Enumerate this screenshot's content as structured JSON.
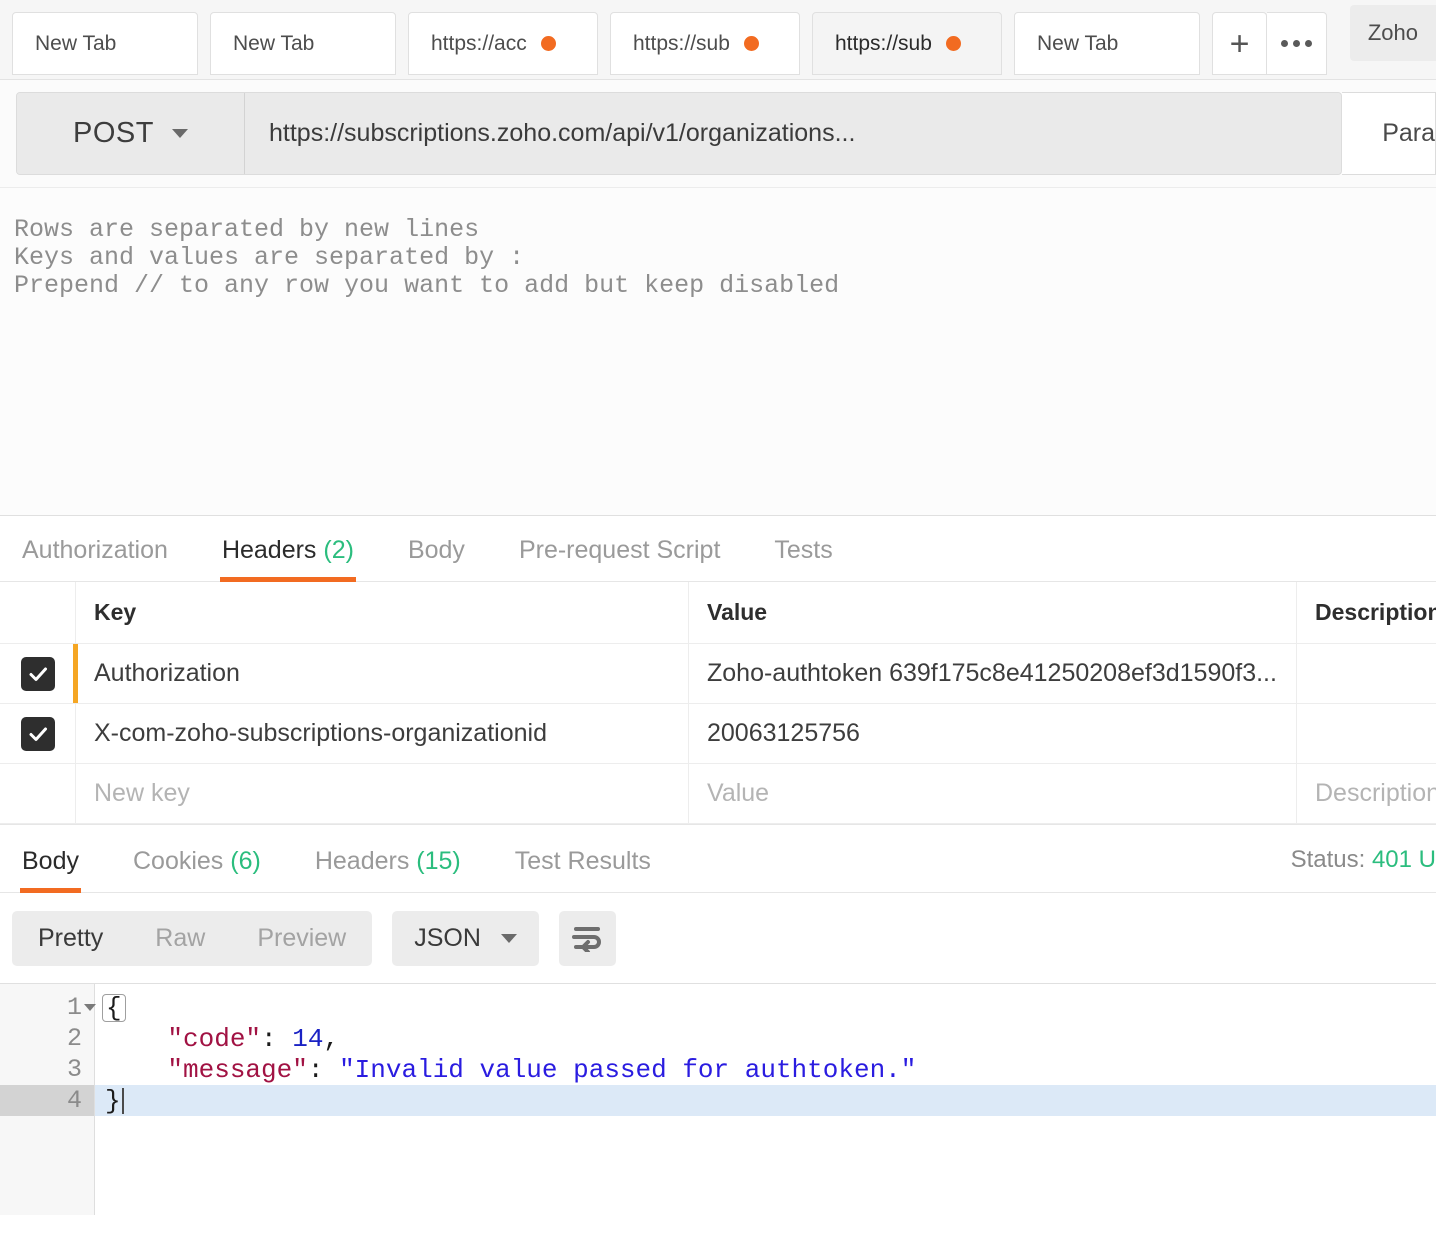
{
  "tabbar": {
    "tabs": [
      {
        "label": "New Tab",
        "dirty": false,
        "active": false
      },
      {
        "label": "New Tab",
        "dirty": false,
        "active": false
      },
      {
        "label": "https://acc",
        "dirty": true,
        "active": false
      },
      {
        "label": "https://sub",
        "dirty": true,
        "active": false
      },
      {
        "label": "https://sub",
        "dirty": true,
        "active": true
      },
      {
        "label": "New Tab",
        "dirty": false,
        "active": false
      }
    ],
    "new_tab_label": "+",
    "more_label": "•••",
    "environment": "Zoho"
  },
  "request": {
    "method": "POST",
    "url": "https://subscriptions.zoho.com/api/v1/organizations...",
    "params_label": "Para"
  },
  "bulk_edit": {
    "line1": "Rows are separated by new lines",
    "line2": "Keys and values are separated by :",
    "line3": "Prepend // to any row you want to add but keep disabled"
  },
  "request_tabs": [
    {
      "label": "Authorization",
      "count": "",
      "active": false
    },
    {
      "label": "Headers",
      "count": "(2)",
      "active": true
    },
    {
      "label": "Body",
      "count": "",
      "active": false
    },
    {
      "label": "Pre-request Script",
      "count": "",
      "active": false
    },
    {
      "label": "Tests",
      "count": "",
      "active": false
    }
  ],
  "headers_table": {
    "columns": {
      "key": "Key",
      "value": "Value",
      "description": "Description"
    },
    "rows": [
      {
        "checked": true,
        "accent": true,
        "key": "Authorization",
        "value": "Zoho-authtoken 639f175c8e41250208ef3d1590f3...",
        "description": ""
      },
      {
        "checked": true,
        "accent": false,
        "key": "X-com-zoho-subscriptions-organizationid",
        "value": "20063125756",
        "description": ""
      }
    ],
    "new_row": {
      "key_placeholder": "New key",
      "value_placeholder": "Value",
      "description_placeholder": "Description"
    }
  },
  "response_tabs": [
    {
      "label": "Body",
      "count": "",
      "active": true
    },
    {
      "label": "Cookies",
      "count": "(6)",
      "active": false
    },
    {
      "label": "Headers",
      "count": "(15)",
      "active": false
    },
    {
      "label": "Test Results",
      "count": "",
      "active": false
    }
  ],
  "response_status": {
    "label": "Status:",
    "value": "401 U"
  },
  "response_toolbar": {
    "views": [
      {
        "label": "Pretty",
        "active": true
      },
      {
        "label": "Raw",
        "active": false
      },
      {
        "label": "Preview",
        "active": false
      }
    ],
    "format": "JSON",
    "wrap_icon": "word-wrap-icon"
  },
  "response_body": {
    "language": "json",
    "line_numbers": [
      "1",
      "2",
      "3",
      "4"
    ],
    "current_line": 4,
    "lines": [
      {
        "open_brace": "{"
      },
      {
        "indent": "    ",
        "key": "\"code\"",
        "colon": ": ",
        "num": "14",
        "comma": ","
      },
      {
        "indent": "    ",
        "key": "\"message\"",
        "colon": ": ",
        "str": "\"Invalid value passed for authtoken.\""
      },
      {
        "close_brace": "}"
      }
    ],
    "raw": "{\n    \"code\": 14,\n    \"message\": \"Invalid value passed for authtoken.\"\n}"
  },
  "colors": {
    "accent_orange": "#f26b21",
    "row_accent": "#f5a623",
    "count_green": "#2bbd7e",
    "json_key": "#a11243",
    "json_string": "#2a1ce0",
    "json_number": "#1a22c4"
  }
}
